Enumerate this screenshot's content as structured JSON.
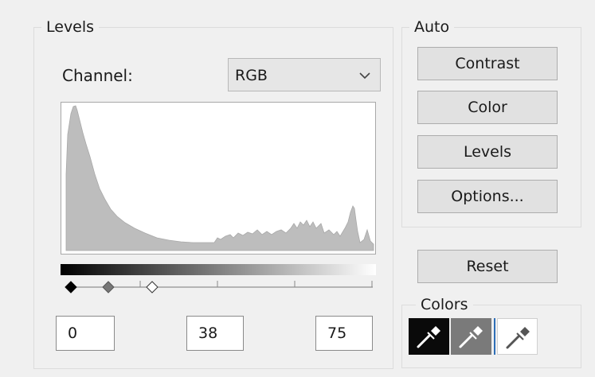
{
  "levels": {
    "group_title": "Levels",
    "channel_label": "Channel:",
    "channel_value": "RGB",
    "input_black": "0",
    "input_mid": "38",
    "input_white": "75"
  },
  "auto": {
    "group_title": "Auto",
    "contrast_label": "Contrast",
    "color_label": "Color",
    "levels_label": "Levels",
    "options_label": "Options..."
  },
  "reset_label": "Reset",
  "colors": {
    "group_title": "Colors",
    "pickers": [
      "black-point-eyedropper-icon",
      "gray-point-eyedropper-icon",
      "white-point-eyedropper-icon"
    ]
  },
  "theme": {
    "histogram_fill": "#bdbdbd",
    "selected_picker_bg": "#0a0a0a",
    "mid_picker_bg": "#7a7a7a",
    "focus_line": "#2f6fb7"
  }
}
